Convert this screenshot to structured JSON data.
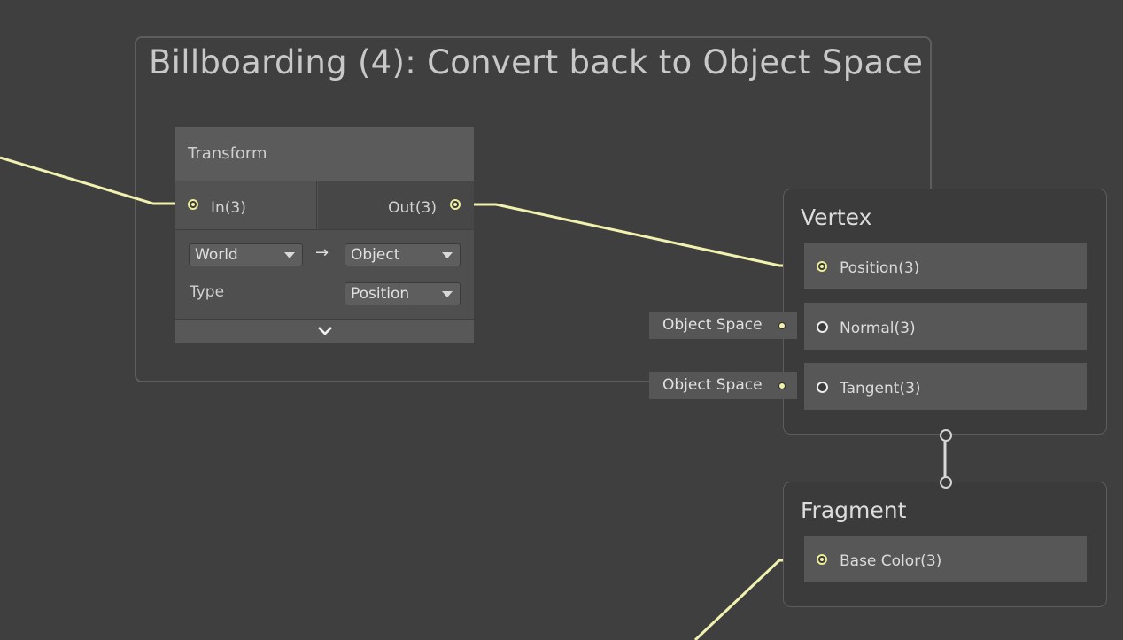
{
  "group": {
    "title": "Billboarding (4): Convert back to Object Space"
  },
  "transform_node": {
    "title": "Transform",
    "input_port": "In(3)",
    "output_port": "Out(3)",
    "from_space": "World",
    "arrow": "→",
    "to_space": "Object",
    "type_label": "Type",
    "type_value": "Position"
  },
  "vertex": {
    "title": "Vertex",
    "blocks": [
      {
        "label": "Position(3)"
      },
      {
        "label": "Normal(3)"
      },
      {
        "label": "Tangent(3)"
      }
    ],
    "normal_default": "Object Space",
    "tangent_default": "Object Space"
  },
  "fragment": {
    "title": "Fragment",
    "blocks": [
      {
        "label": "Base Color(3)"
      }
    ]
  },
  "colors": {
    "background": "#3f3f3f",
    "wire": "#f2f2b0",
    "node_body": "#525252",
    "group_border": "#5d5d5d"
  }
}
